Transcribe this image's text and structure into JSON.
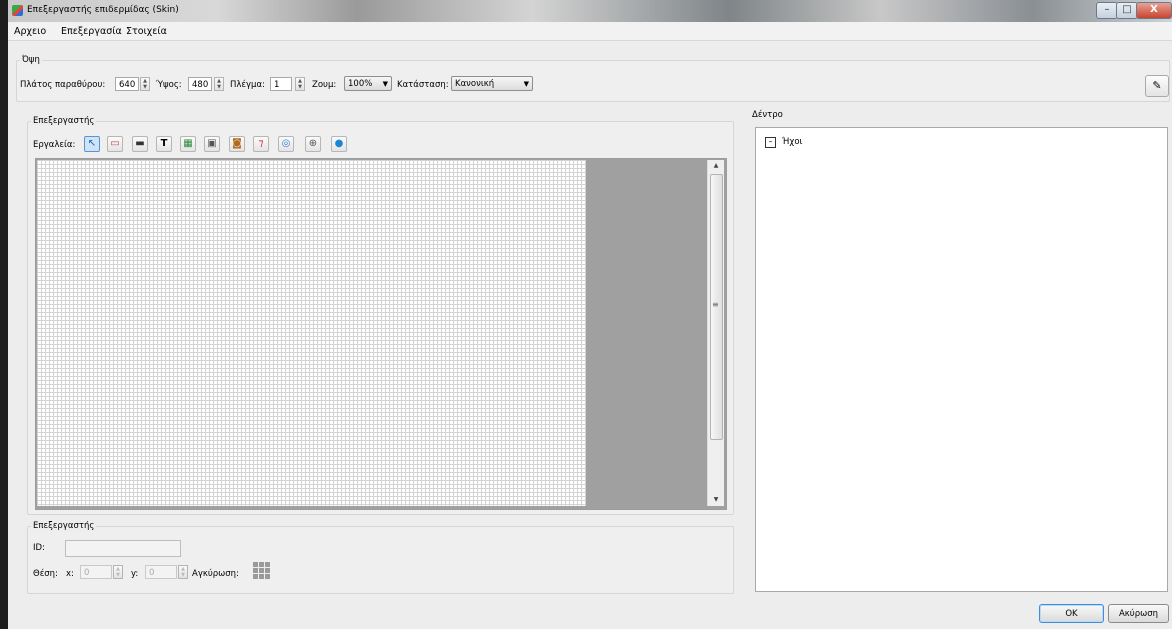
{
  "window": {
    "title": "Επεξεργαστής επιδερμίδας (Skin)",
    "min": "–",
    "max": "□",
    "close": "X"
  },
  "menu": {
    "items": [
      "Αρχειο",
      "Επεξεργασία",
      "Στοιχεία"
    ]
  },
  "view": {
    "group_label": "Όψη",
    "width_label": "Πλάτος παραθύρου:",
    "width_value": "640",
    "height_label": "Ύψος:",
    "height_value": "480",
    "grid_label": "Πλέγμα:",
    "grid_value": "1",
    "zoom_label": "Ζουμ:",
    "zoom_value": "100%",
    "state_label": "Κατάσταση:",
    "state_value": "Κανονική"
  },
  "editor": {
    "group_label": "Επεξεργαστής",
    "tools_label": "Εργαλεία:",
    "tools": [
      "pointer-icon",
      "rectangle-icon",
      "panel-icon",
      "text-icon",
      "image-icon",
      "button-image-icon",
      "animation-icon",
      "checkbox-icon",
      "globe-icon",
      "crosshair-icon",
      "bubble-icon"
    ],
    "tool_glyphs": [
      "↖",
      "▭",
      "▬",
      "T",
      "▦",
      "▣",
      "◙",
      "⁊",
      "◎",
      "⊕",
      "●"
    ]
  },
  "tree": {
    "group_label": "Δέντρο",
    "root_label": "Ήχοι",
    "root_glyph": "–"
  },
  "properties": {
    "group_label": "Επεξεργαστής",
    "id_label": "ID:",
    "position_label": "Θέση:",
    "x_label": "x:",
    "x_value": "0",
    "y_label": "y:",
    "y_value": "0",
    "anchor_label": "Αγκύρωση:"
  },
  "buttons": {
    "ok": "OK",
    "cancel": "Ακύρωση"
  },
  "colors": {
    "window_bg": "#ededed",
    "canvas_bg": "#a0a0a0",
    "grid_line": "#d3d3d3"
  }
}
